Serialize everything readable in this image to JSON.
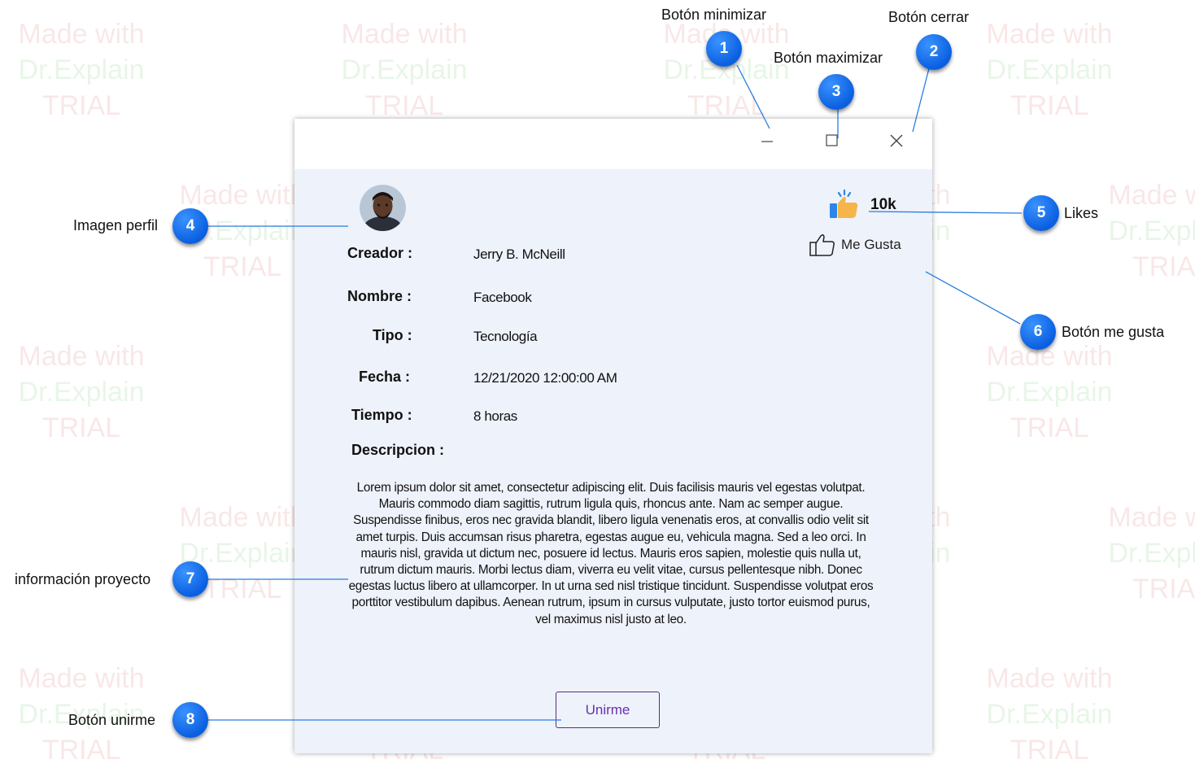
{
  "watermark": {
    "line1": "Made with",
    "line2": "Dr.Explain",
    "line3": "TRIAL"
  },
  "window": {
    "creator_label": "Creador :",
    "creator_value": "Jerry B. McNeill",
    "name_label": "Nombre :",
    "name_value": "Facebook",
    "type_label": "Tipo :",
    "type_value": "Tecnología",
    "date_label": "Fecha :",
    "date_value": "12/21/2020 12:00:00 AM",
    "time_label": "Tiempo :",
    "time_value": "8 horas",
    "description_label": "Descripcion :",
    "description_text": "Lorem ipsum dolor sit amet, consectetur adipiscing elit. Duis facilisis mauris vel egestas volutpat. Mauris commodo diam sagittis, rutrum ligula quis, rhoncus ante. Nam ac semper augue. Suspendisse finibus, eros nec gravida blandit, libero ligula venenatis eros, at convallis odio velit sit amet turpis. Duis accumsan risus pharetra, egestas augue eu, vehicula magna. Sed a leo orci. In mauris nisl, gravida ut dictum nec, posuere id lectus. Mauris eros sapien, molestie quis nulla ut, rutrum dictum mauris. Morbi lectus diam, viverra eu velit vitae, cursus pellentesque nibh. Donec egestas luctus libero at ullamcorper. In ut urna sed nisl tristique tincidunt. Suspendisse volutpat eros porttitor vestibulum dapibus. Aenean rutrum, ipsum in cursus vulputate, justo tortor euismod purus, vel maximus nisl justo at leo.",
    "likes_count": "10k",
    "like_button_label": "Me Gusta",
    "join_button_label": "Unirme"
  },
  "annotations": [
    {
      "number": "1",
      "label": "Botón  minimizar"
    },
    {
      "number": "2",
      "label": "Botón cerrar"
    },
    {
      "number": "3",
      "label": "Botón maximizar"
    },
    {
      "number": "4",
      "label": "Imagen perfil"
    },
    {
      "number": "5",
      "label": "Likes"
    },
    {
      "number": "6",
      "label": "Botón me gusta"
    },
    {
      "number": "7",
      "label": "información proyecto"
    },
    {
      "number": "8",
      "label": "Botón unirme"
    }
  ],
  "colors": {
    "annotation_blue": "#0a5fe0",
    "join_border": "#5b2a86",
    "window_bg": "#eef2fa"
  }
}
